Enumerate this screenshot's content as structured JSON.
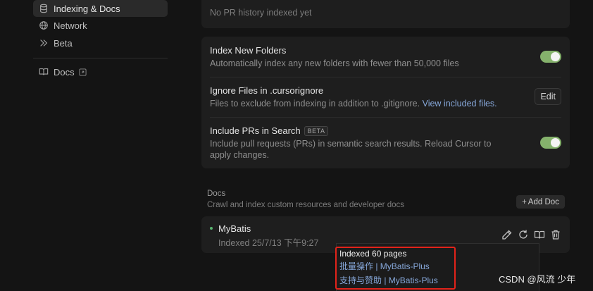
{
  "sidebar": {
    "items": [
      {
        "label": "Indexing & Docs",
        "icon": "database-icon",
        "active": true
      },
      {
        "label": "Network",
        "icon": "globe-icon",
        "active": false
      },
      {
        "label": "Beta",
        "icon": "double-chevron-icon",
        "active": false
      },
      {
        "label": "Docs",
        "icon": "book-icon",
        "active": false
      }
    ]
  },
  "pr_history": {
    "empty_text": "No PR history indexed yet"
  },
  "settings": {
    "index_new_folders": {
      "title": "Index New Folders",
      "description": "Automatically index any new folders with fewer than 50,000 files",
      "enabled": true
    },
    "ignore_files": {
      "title": "Ignore Files in .cursorignore",
      "description": "Files to exclude from indexing in addition to .gitignore.",
      "link": "View included files.",
      "button": "Edit"
    },
    "include_prs": {
      "title": "Include PRs in Search",
      "badge": "BETA",
      "description": "Include pull requests (PRs) in semantic search results. Reload Cursor to apply changes.",
      "enabled": true
    }
  },
  "docs": {
    "title": "Docs",
    "description": "Crawl and index custom resources and developer docs",
    "add_button": "Add Doc",
    "items": [
      {
        "name": "MyBatis",
        "status": "Indexed 25/7/13 下午9:27"
      }
    ]
  },
  "tooltip": {
    "title": "Indexed 60 pages",
    "pages": [
      "批量操作 | MyBatis-Plus",
      "支持与赞助 | MyBatis-Plus"
    ]
  },
  "watermark": "CSDN @风流 少年",
  "colors": {
    "toggle_on": "#85b26c",
    "link": "#86a7d9",
    "highlight": "#e2231a",
    "status_dot": "#58b36f"
  }
}
